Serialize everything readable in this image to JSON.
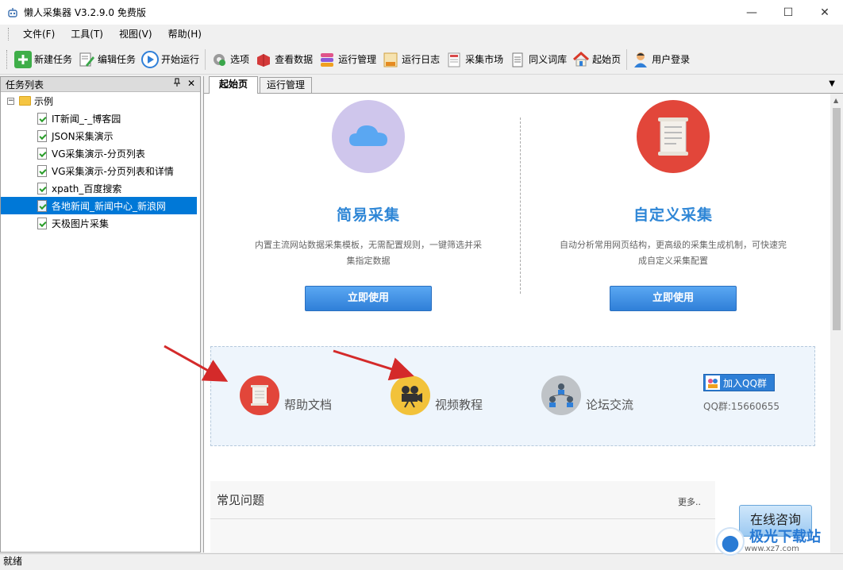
{
  "window": {
    "title": "懒人采集器 V3.2.9.0 免费版",
    "minimize": "—",
    "maximize": "☐",
    "close": "✕"
  },
  "menu": [
    "文件(F)",
    "工具(T)",
    "视图(V)",
    "帮助(H)"
  ],
  "toolbar": {
    "new_task": "新建任务",
    "edit_task": "编辑任务",
    "start_run": "开始运行",
    "options": "选项",
    "view_data": "查看数据",
    "run_manage": "运行管理",
    "run_log": "运行日志",
    "market": "采集市场",
    "synonyms": "同义词库",
    "start_page": "起始页",
    "user_login": "用户登录"
  },
  "task_panel": {
    "title": "任务列表",
    "pin": "ᵖ",
    "close": "✕",
    "root": "示例",
    "items": [
      "IT新闻_-_博客园",
      "JSON采集演示",
      "VG采集演示-分页列表",
      "VG采集演示-分页列表和详情",
      "xpath_百度搜索",
      "各地新闻_新闻中心_新浪网",
      "天极图片采集"
    ],
    "selected_index": 5
  },
  "tabs": [
    "起始页",
    "运行管理"
  ],
  "start_page": {
    "simple": {
      "title": "简易采集",
      "desc": "内置主流网站数据采集模板，无需配置规则，一键筛选并采集指定数据",
      "button": "立即使用"
    },
    "custom": {
      "title": "自定义采集",
      "desc": "自动分析常用网页结构，更高级的采集生成机制，可快速完成自定义采集配置",
      "button": "立即使用"
    },
    "help": {
      "docs": "帮助文档",
      "video": "视频教程",
      "forum": "论坛交流",
      "qq_button": "加入QQ群",
      "qq_number": "QQ群:15660655"
    },
    "faq": {
      "title": "常见问题",
      "more": "更多.."
    },
    "consult": "在线咨询"
  },
  "status": "就绪",
  "watermark": {
    "name": "极光下载站",
    "url": "www.xz7.com"
  },
  "colors": {
    "accent_blue": "#2e86d6",
    "selection": "#0078d7",
    "annotation_arrow": "#d42a2a"
  }
}
